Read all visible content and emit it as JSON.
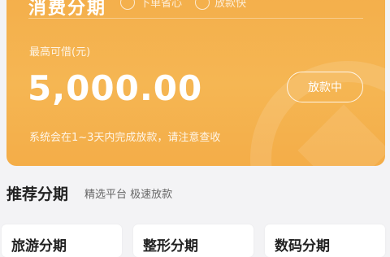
{
  "card": {
    "title": "消费分期",
    "features": [
      "下单省心",
      "放款快"
    ],
    "limit_label": "最高可借(元)",
    "amount": "5,000.00",
    "status_button": "放款中",
    "notice": "系统会在1~3天内完成放款，请注意查收"
  },
  "recommend": {
    "title": "推荐分期",
    "subtitle": "精选平台 极速放款",
    "items": [
      "旅游分期",
      "整形分期",
      "数码分期"
    ]
  },
  "colors": {
    "card_orange": "#f4ae4a",
    "page_bg": "#f3f3f5"
  }
}
